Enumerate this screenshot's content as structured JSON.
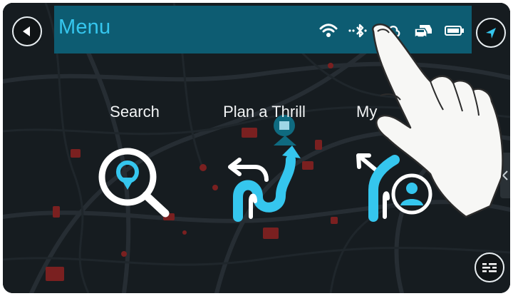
{
  "header": {
    "title": "Menu"
  },
  "status_icons": [
    "wifi-icon",
    "bluetooth-icon",
    "cloud-icon",
    "traffic-icon",
    "battery-icon"
  ],
  "menu": {
    "items": [
      {
        "label": "Search",
        "icon": "search-icon"
      },
      {
        "label": "Plan a Thrill",
        "icon": "winding-road-icon"
      },
      {
        "label": "My",
        "icon": "my-routes-icon"
      }
    ]
  },
  "colors": {
    "accent": "#35c6ee",
    "header_bg": "#0d5c72"
  }
}
